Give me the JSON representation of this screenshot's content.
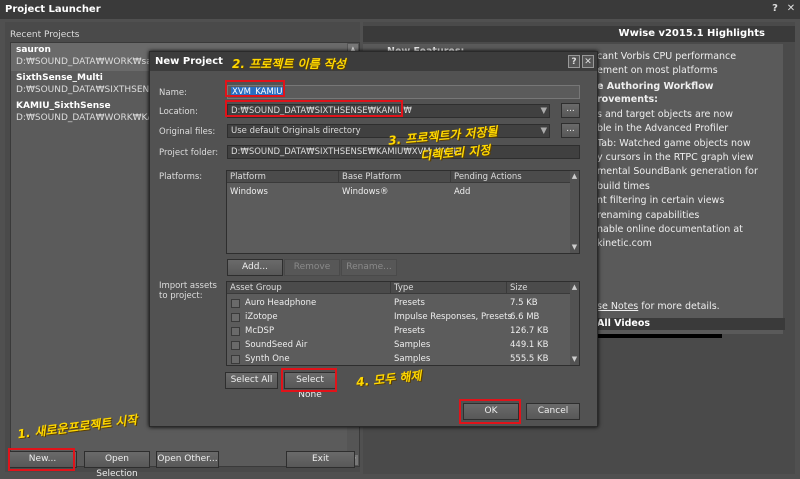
{
  "launcher": {
    "title": "Project Launcher",
    "title_buttons": [
      "?",
      "✕"
    ],
    "recent_label": "Recent Projects",
    "recent_projects": [
      {
        "name": "sauron",
        "path": "D:₩SOUND_DATA₩WORK₩sauron₩sauron.wproj"
      },
      {
        "name": "SixthSense_Multi",
        "path": "D:₩SOUND_DATA₩SIXTHSENSE₩SixthSense_Multi"
      },
      {
        "name": "KAMIU_SixthSense",
        "path": "D:₩SOUND_DATA₩WORK₩KAMIU_SixthSense"
      }
    ],
    "buttons": {
      "new": "New...",
      "open_selection": "Open Selection",
      "open_other": "Open Other...",
      "exit": "Exit"
    }
  },
  "highlights": {
    "title": "Wwise v2015.1 Highlights",
    "partial_label": "New Features:",
    "lines": [
      "cant Vorbis CPU performance",
      "ement on most platforms",
      "e Authoring Workflow",
      "rovements:",
      "s and target objects are now",
      "ble in the Advanced Profiler",
      "Tab: Watched game objects now",
      "y cursors in the RTPC graph view",
      "mental SoundBank generation for",
      "build times",
      "nt filtering in certain views",
      "renaming capabilities",
      "nable online documentation at",
      "kinetic.com"
    ],
    "release_notes": {
      "link": "se Notes",
      "suffix": " for more details."
    },
    "videos": "All Videos"
  },
  "dialog": {
    "title": "New Project",
    "title_buttons": [
      "?",
      "✕"
    ],
    "name_label": "Name:",
    "name_value": "XVM_KAMIU",
    "location_label": "Location:",
    "location_value": "D:₩SOUND_DATA₩SIXTHSENSE₩KAMIU₩",
    "original_label": "Original files:",
    "original_value": "Use default Originals directory",
    "folder_label": "Project folder:",
    "folder_value": "D:₩SOUND_DATA₩SIXTHSENSE₩KAMIU₩XVM_KAMIU",
    "dots": "...",
    "platforms_label": "Platforms:",
    "platform_headers": [
      "Platform",
      "Base Platform",
      "Pending Actions"
    ],
    "platform_rows": [
      [
        "Windows",
        "Windows®",
        "Add"
      ]
    ],
    "platform_buttons": {
      "add": "Add...",
      "remove": "Remove",
      "rename": "Rename..."
    },
    "import_label": "Import assets to project:",
    "asset_headers": [
      "Asset Group",
      "Type",
      "Size"
    ],
    "assets": [
      [
        "Auro Headphone",
        "Presets",
        "7.5 KB"
      ],
      [
        "iZotope",
        "Impulse Responses, Presets",
        "6.6 MB"
      ],
      [
        "McDSP",
        "Presets",
        "126.7 KB"
      ],
      [
        "SoundSeed Air",
        "Samples",
        "449.1 KB"
      ],
      [
        "Synth One",
        "Samples",
        "555.5 KB"
      ]
    ],
    "select_all": "Select All",
    "select_none": "Select None",
    "ok": "OK",
    "cancel": "Cancel"
  },
  "annotations": {
    "step1": "1. 새로운프로젝트 시작",
    "step2": "2. 프로젝트 이름 작성",
    "step3a": "3. 프로젝트가 저장될",
    "step3b": "디렉토리 지정",
    "step4": "4. 모두 해제"
  },
  "colors": {
    "highlight_red": "#e0131a",
    "note_yellow": "#ffd800"
  }
}
